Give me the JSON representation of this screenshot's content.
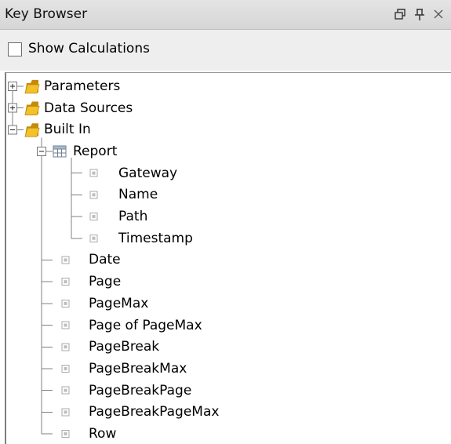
{
  "window": {
    "title": "Key Browser",
    "buttons": [
      {
        "name": "restore-icon"
      },
      {
        "name": "pin-icon"
      },
      {
        "name": "close-icon"
      }
    ]
  },
  "toolbar": {
    "show_calculations_label": "Show Calculations",
    "show_calculations_checked": false
  },
  "tree": {
    "parameters": "Parameters",
    "data_sources": "Data Sources",
    "built_in": "Built In",
    "report": "Report",
    "report_children": [
      "Gateway",
      "Name",
      "Path",
      "Timestamp"
    ],
    "built_in_children": [
      "Date",
      "Page",
      "PageMax",
      "Page of PageMax",
      "PageBreak",
      "PageBreakMax",
      "PageBreakPage",
      "PageBreakPageMax",
      "Row"
    ]
  },
  "colors": {
    "folder": "#f2c22a",
    "folder_dark": "#c58a0a",
    "line": "#808080"
  }
}
